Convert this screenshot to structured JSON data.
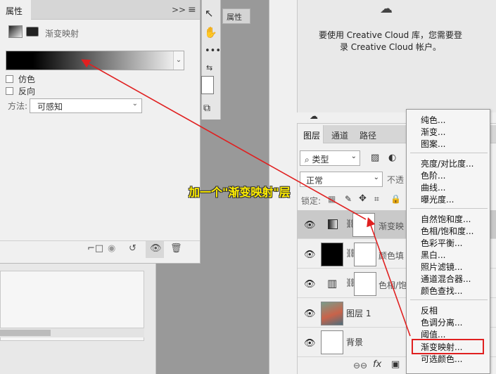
{
  "properties_panel": {
    "tab_title": "属性",
    "menu_glyph": ">>",
    "menu_icon": "≡",
    "subtitle": "渐变映射",
    "dither_label": "仿色",
    "reverse_label": "反向",
    "method_label": "方法:",
    "method_value": "可感知"
  },
  "mini_props_tab": "属性",
  "cc_panel": {
    "message_line1": "要使用 Creative Cloud 库，您需要登",
    "message_line2": "录 Creative Cloud 帐户。"
  },
  "layers_panel": {
    "tabs": [
      "图层",
      "通道",
      "路径"
    ],
    "kind_filter": "类型",
    "blend_mode": "正常",
    "opacity_label": "不透",
    "lock_label": "锁定:",
    "layers": [
      {
        "name": "渐变映",
        "selected": true
      },
      {
        "name": "颜色填",
        "selected": false
      },
      {
        "name": "色相/饱",
        "selected": false
      },
      {
        "name": "图层 1",
        "selected": false
      },
      {
        "name": "背景",
        "selected": false
      }
    ]
  },
  "adjustment_menu": {
    "items": [
      "纯色...",
      "渐变...",
      "图案...",
      "亮度/对比度...",
      "色阶...",
      "曲线...",
      "曝光度...",
      "自然饱和度...",
      "色相/饱和度...",
      "色彩平衡...",
      "黑白...",
      "照片滤镜...",
      "通道混合器...",
      "颜色查找...",
      "反相",
      "色调分离...",
      "阈值...",
      "渐变映射...",
      "可选颜色..."
    ],
    "highlighted": "渐变映射..."
  },
  "annotation": {
    "callout_text": "加一个\"渐变映射\"层",
    "color": "#e02020"
  },
  "colors": {
    "panel_bg": "#f0f0f0",
    "canvas_bg": "#999999",
    "highlight_red": "#e02020",
    "callout_yellow": "#ffee00"
  }
}
